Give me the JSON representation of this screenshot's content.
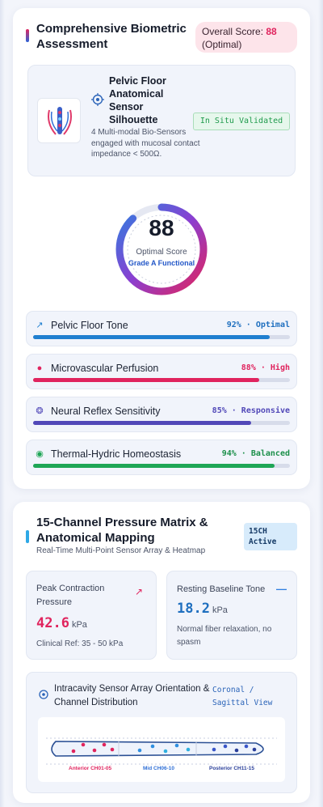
{
  "assessment": {
    "title": "Comprehensive Biometric Assessment",
    "score_label": "Overall Score:",
    "score_value": "88",
    "score_status": "(Optimal)",
    "sensor": {
      "title": "Pelvic Floor Anatomical Sensor Silhouette",
      "description": "4 Multi-modal Bio-Sensors engaged with mucosal contact impedance < 500Ω.",
      "badge": "In Situ Validated"
    },
    "gauge": {
      "value": "88",
      "fraction": 0.88,
      "label": "Optimal Score",
      "grade": "Grade A Functional"
    },
    "metrics": [
      {
        "label": "Pelvic Floor Tone",
        "value": "92% · Optimal",
        "percent": 92,
        "color": "#1f7fd0",
        "icon": "expand-arrows-icon"
      },
      {
        "label": "Microvascular Perfusion",
        "value": "88% · High",
        "percent": 88,
        "color": "#e0245e",
        "icon": "droplet-icon"
      },
      {
        "label": "Neural Reflex Sensitivity",
        "value": "85% · Responsive",
        "percent": 85,
        "color": "#5148b8",
        "icon": "brain-icon"
      },
      {
        "label": "Thermal-Hydric Homeostasis",
        "value": "94% · Balanced",
        "percent": 94,
        "color": "#1fa656",
        "icon": "thermal-drop-icon"
      }
    ]
  },
  "pressure": {
    "title": "15-Channel Pressure Matrix & Anatomical Mapping",
    "subtitle": "Real-Time Multi-Point Sensor Array & Heatmap",
    "badge": "15CH Active",
    "peak": {
      "label": "Peak Contraction Pressure",
      "value": "42.6",
      "unit": "kPa",
      "note": "Clinical Ref: 35 - 50 kPa"
    },
    "resting": {
      "label": "Resting Baseline Tone",
      "value": "18.2",
      "unit": "kPa",
      "note": "Normal fiber relaxation, no spasm"
    },
    "orientation": {
      "title": "Intracavity Sensor Array Orientation & Channel Distribution",
      "view": "Coronal / Sagittal View",
      "zones": [
        "Anterior CH01-05",
        "Mid CH06-10",
        "Posterior CH11-15"
      ]
    }
  }
}
